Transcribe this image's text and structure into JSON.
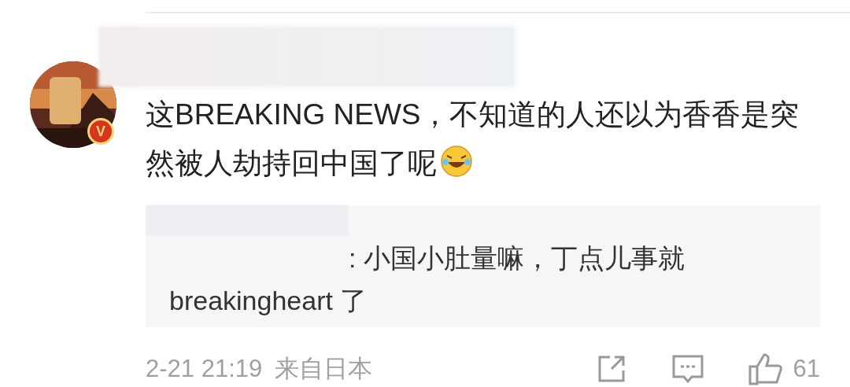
{
  "comment": {
    "badge": "V",
    "text": "这BREAKING NEWS，不知道的人还以为香香是突然被人劫持回中国了呢",
    "reply": {
      "text": ": 小国小肚量嘛，丁点儿事就 breakingheart 了"
    },
    "footer": {
      "time": "2-21 21:19",
      "source": "来自日本",
      "likes": "61"
    }
  }
}
